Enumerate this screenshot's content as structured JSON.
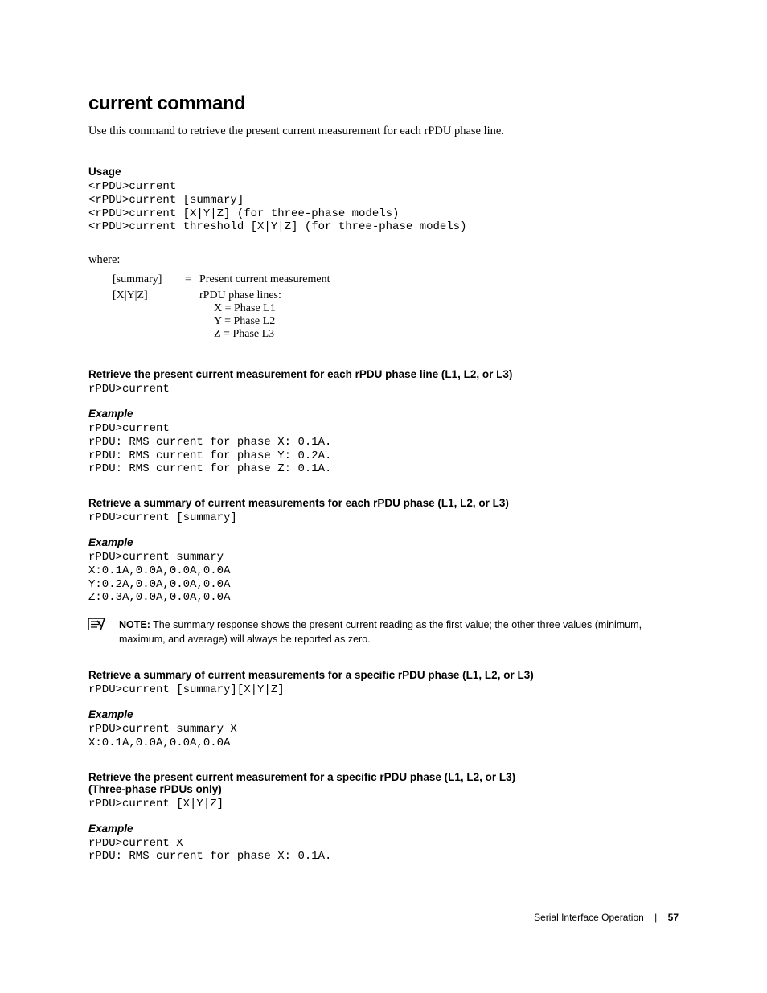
{
  "title": "current command",
  "intro": "Use this command to retrieve the present current measurement for each rPDU phase line.",
  "usage": {
    "heading": "Usage",
    "lines": "<rPDU>current\n<rPDU>current [summary]\n<rPDU>current [X|Y|Z] (for three-phase models)\n<rPDU>current threshold [X|Y|Z] (for three-phase models)"
  },
  "where": {
    "label": "where:",
    "defs": {
      "summary_key": "[summary]",
      "summary_eq": "=",
      "summary_desc": "Present current measurement",
      "xyz_key": "[X|Y|Z]",
      "xyz_desc": "rPDU phase lines:",
      "phase_x": "X = Phase L1",
      "phase_y": "Y = Phase L2",
      "phase_z": "Z = Phase L3"
    }
  },
  "sec1": {
    "heading": "Retrieve the present current measurement for each rPDU phase line (L1, L2, or L3)",
    "cmd": "rPDU>current",
    "example_heading": "Example",
    "example": "rPDU>current\nrPDU: RMS current for phase X: 0.1A.\nrPDU: RMS current for phase Y: 0.2A.\nrPDU: RMS current for phase Z: 0.1A."
  },
  "sec2": {
    "heading": "Retrieve a summary of current measurements for each rPDU phase (L1, L2, or L3)",
    "cmd": "rPDU>current [summary]",
    "example_heading": "Example",
    "example": "rPDU>current summary\nX:0.1A,0.0A,0.0A,0.0A\nY:0.2A,0.0A,0.0A,0.0A\nZ:0.3A,0.0A,0.0A,0.0A"
  },
  "note": {
    "label": "NOTE:",
    "text": " The summary response shows the present current reading as the first value; the other three values (minimum, maximum, and average) will always be reported as zero."
  },
  "sec3": {
    "heading": "Retrieve a summary of current measurements for a specific rPDU phase (L1, L2, or L3)",
    "cmd": "rPDU>current [summary][X|Y|Z]",
    "example_heading": "Example",
    "example": "rPDU>current summary X\nX:0.1A,0.0A,0.0A,0.0A"
  },
  "sec4": {
    "heading": "Retrieve the present current measurement for a specific rPDU phase (L1, L2, or L3) (Three-phase rPDUs only)",
    "cmd": "rPDU>current [X|Y|Z]",
    "example_heading": "Example",
    "example": "rPDU>current X\nrPDU: RMS current for phase X: 0.1A."
  },
  "footer": {
    "section": "Serial Interface Operation",
    "page": "57"
  }
}
